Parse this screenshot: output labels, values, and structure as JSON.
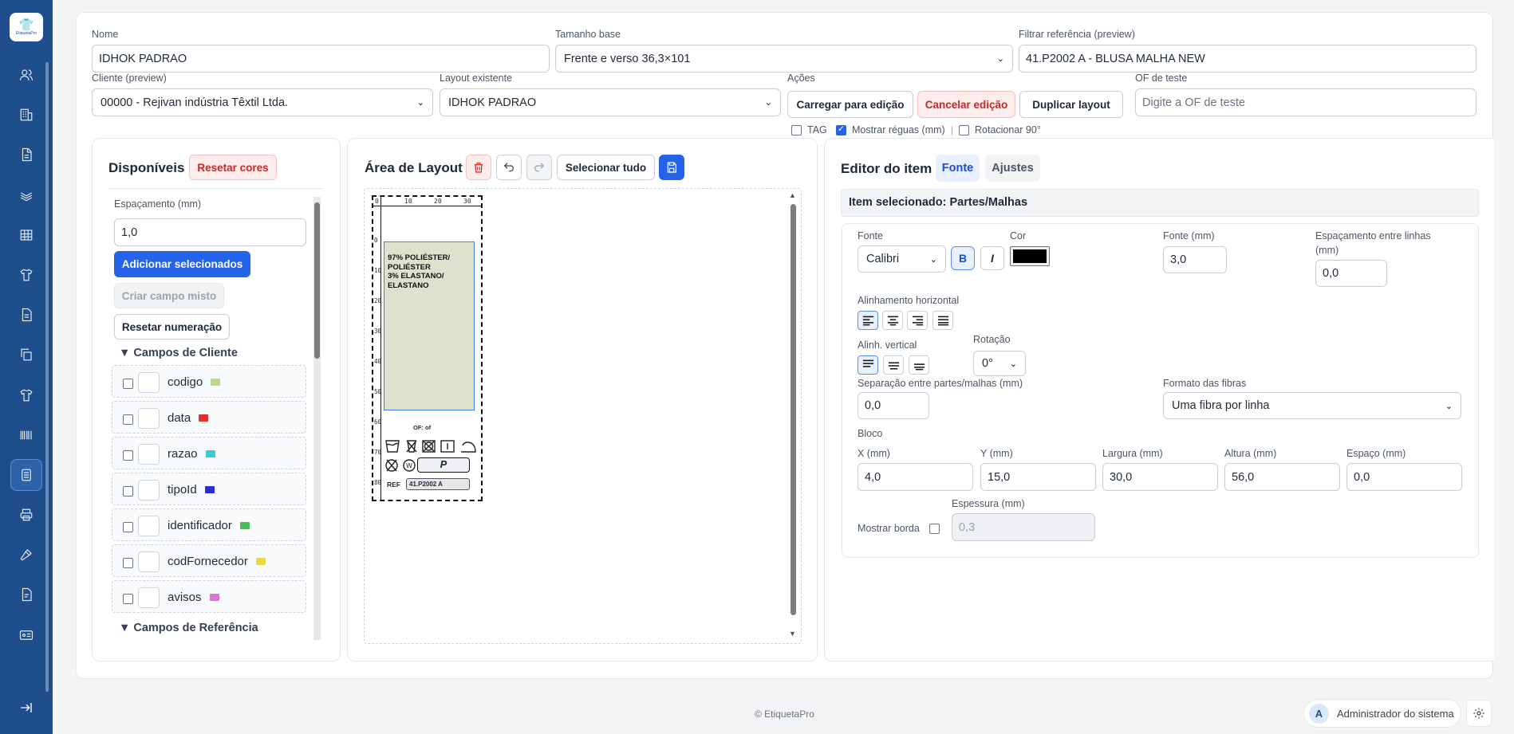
{
  "app": {
    "logo_text": "EtiquetaPro"
  },
  "form": {
    "nome": {
      "label": "Nome",
      "value": "IDHOK PADRAO"
    },
    "tamanho": {
      "label": "Tamanho base",
      "value": "Frente e verso 36,3×101"
    },
    "filtrar": {
      "label": "Filtrar referência (preview)",
      "value": "41.P2002 A - BLUSA MALHA NEW"
    },
    "cliente": {
      "label": "Cliente (preview)",
      "value": "00000 - Rejivan indústria Têxtil Ltda."
    },
    "layout": {
      "label": "Layout existente",
      "value": "IDHOK PADRAO"
    },
    "acoes": {
      "label": "Ações",
      "carregar": "Carregar para edição",
      "cancelar": "Cancelar edição",
      "duplicar": "Duplicar layout"
    },
    "of": {
      "label": "OF de teste",
      "placeholder": "Digite a OF de teste"
    },
    "options": {
      "tag": "TAG",
      "reguas": "Mostrar réguas (mm)",
      "rotacionar": "Rotacionar 90°",
      "tag_checked": false,
      "reguas_checked": true,
      "rotacionar_checked": false
    }
  },
  "disponiveis": {
    "title": "Disponíveis",
    "reset_colors": "Resetar cores",
    "espacamento_label": "Espaçamento (mm)",
    "espacamento_value": "1,0",
    "add_selected": "Adicionar selecionados",
    "criar_misto": "Criar campo misto",
    "reset_num": "Resetar numeração",
    "section_cliente": "▼ Campos de Cliente",
    "section_referencia": "▼ Campos de Referência",
    "fields": [
      {
        "name": "codigo",
        "color": "#b7d98a"
      },
      {
        "name": "data",
        "color": "#e03131"
      },
      {
        "name": "razao",
        "color": "#3bc9db"
      },
      {
        "name": "tipoId",
        "color": "#2b2bd6"
      },
      {
        "name": "identificador",
        "color": "#40c057"
      },
      {
        "name": "codFornecedor",
        "color": "#e6d84a"
      },
      {
        "name": "avisos",
        "color": "#e36fd8"
      }
    ]
  },
  "layout_area": {
    "title": "Área de Layout",
    "select_all": "Selecionar tudo",
    "ruler_top": [
      "0",
      "10",
      "20",
      "30"
    ],
    "ruler_left": [
      "0",
      "10",
      "20",
      "30",
      "40",
      "50",
      "60",
      "70",
      "80"
    ],
    "composition": [
      "97% POLIÉSTER/",
      "POLIÉSTER",
      "3% ELASTANO/",
      "ELASTANO"
    ],
    "of_text": "OF:   of",
    "size": "P",
    "ref_label": "REF",
    "ref_value": "41.P2002 A"
  },
  "editor": {
    "title": "Editor do item",
    "tab_fonte": "Fonte",
    "tab_ajustes": "Ajustes",
    "selected": "Item selecionado: Partes/Malhas",
    "fonte_label": "Fonte",
    "fonte_value": "Calibri",
    "bold": "B",
    "italic": "I",
    "cor_label": "Cor",
    "cor_value": "#000000",
    "fonte_mm_label": "Fonte (mm)",
    "fonte_mm_value": "3,0",
    "espacamento_linhas_label": "Espaçamento entre linhas",
    "espacamento_linhas_label2": "(mm)",
    "espacamento_linhas_value": "0,0",
    "alinh_h_label": "Alinhamento horizontal",
    "alinh_v_label": "Alinh. vertical",
    "rotacao_label": "Rotação",
    "rotacao_value": "0°",
    "separacao_label": "Separação entre partes/malhas (mm)",
    "separacao_value": "0,0",
    "formato_label": "Formato das fibras",
    "formato_value": "Uma fibra por linha",
    "bloco_label": "Bloco",
    "x_label": "X (mm)",
    "x_value": "4,0",
    "y_label": "Y (mm)",
    "y_value": "15,0",
    "largura_label": "Largura (mm)",
    "largura_value": "30,0",
    "altura_label": "Altura (mm)",
    "altura_value": "56,0",
    "espaco_label": "Espaço (mm)",
    "espaco_value": "0,0",
    "mostrar_borda": "Mostrar borda",
    "espessura_label": "Espessura (mm)",
    "espessura_placeholder": "0,3"
  },
  "footer": {
    "copyright": "© EtiquetaPro",
    "user_initial": "A",
    "user_name": "Administrador do sistema"
  }
}
